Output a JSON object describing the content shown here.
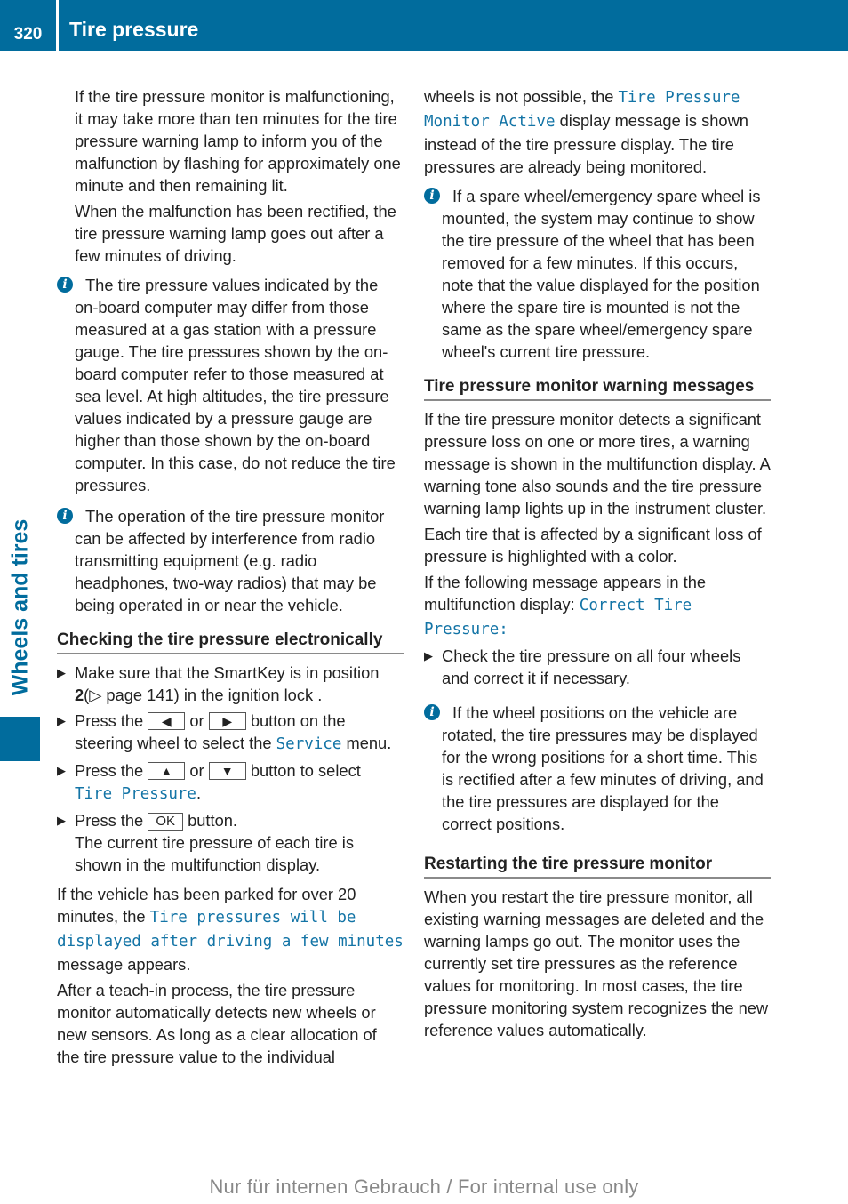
{
  "header": {
    "page_number": "320",
    "title": "Tire pressure"
  },
  "side_tab": {
    "label": "Wheels and tires"
  },
  "colors": {
    "brand_blue": "#016c9d",
    "mono_blue": "#1374a6"
  },
  "left": {
    "p1": "If the tire pressure monitor is malfunctioning, it may take more than ten minutes for the tire pressure warning lamp to inform you of the malfunction by flashing for approximately one minute and then remaining lit.",
    "p2": "When the malfunction has been rectified, the tire pressure warning lamp goes out after a few minutes of driving.",
    "info1": "The tire pressure values indicated by the on-board computer may differ from those measured at a gas station with a pressure gauge. The tire pressures shown by the on-board computer refer to those measured at sea level. At high altitudes, the tire pressure values indicated by a pressure gauge are higher than those shown by the on-board computer. In this case, do not reduce the tire pressures.",
    "info2": "The operation of the tire pressure monitor can be affected by interference from radio transmitting equipment (e.g. radio headphones, two-way radios) that may be being operated in or near the vehicle.",
    "heading": "Checking the tire pressure electronically",
    "step1": {
      "a": "Make sure that the SmartKey is in position ",
      "b": "2",
      "c": "(▷ page 141) in the ignition lock ."
    },
    "step2": {
      "a": "Press the ",
      "btn1": "◀",
      "or": " or ",
      "btn2": "▶",
      "b": " button on the steering wheel to select the ",
      "mono": "Service",
      "c": " menu."
    },
    "step3": {
      "a": "Press the ",
      "btn1": "▲",
      "or": " or ",
      "btn2": "▼",
      "b": " button to select ",
      "mono": "Tire Pressure",
      "c": "."
    },
    "step4": {
      "a": "Press the ",
      "btn": "OK",
      "b": " button.",
      "result": "The current tire pressure of each tire is shown in the multifunction display."
    },
    "p3": {
      "a": "If the vehicle has been parked for over 20 minutes, the ",
      "mono": "Tire pressures will be displayed after driving a few minutes",
      "b": " message appears."
    },
    "p4": "After a teach-in process, the tire pressure monitor automatically detects new wheels or new sensors. As long as a clear allocation of the tire pressure value to the individual"
  },
  "right": {
    "p1": {
      "a": "wheels is not possible, the ",
      "mono": "Tire Pressure Monitor Active",
      "b": " display message is shown instead of the tire pressure display. The tire pressures are already being monitored."
    },
    "info1": "If a spare wheel/emergency spare wheel is mounted, the system may continue to show the tire pressure of the wheel that has been removed for a few minutes. If this occurs, note that the value displayed for the position where the spare tire is mounted is not the same as the spare wheel/emergency spare wheel's current tire pressure.",
    "heading1": "Tire pressure monitor warning messages",
    "p2": "If the tire pressure monitor detects a significant pressure loss on one or more tires, a warning message is shown in the multifunction display. A warning tone also sounds and the tire pressure warning lamp lights up in the instrument cluster.",
    "p3": "Each tire that is affected by a significant loss of pressure is highlighted with a color.",
    "p4": {
      "a": "If the following message appears in the multifunction display: ",
      "mono": "Correct Tire Pressure:"
    },
    "step1": "Check the tire pressure on all four wheels and correct it if necessary.",
    "info2": "If the wheel positions on the vehicle are rotated, the tire pressures may be displayed for the wrong positions for a short time. This is rectified after a few minutes of driving, and the tire pressures are displayed for the correct positions.",
    "heading2": "Restarting the tire pressure monitor",
    "p5": "When you restart the tire pressure monitor, all existing warning messages are deleted and the warning lamps go out. The monitor uses the currently set tire pressures as the reference values for monitoring. In most cases, the tire pressure monitoring system recognizes the new reference values automatically."
  },
  "icons": {
    "info": "i",
    "step_bullet": "▶"
  },
  "footer": {
    "watermark": "Nur für internen Gebrauch / For internal use only"
  }
}
